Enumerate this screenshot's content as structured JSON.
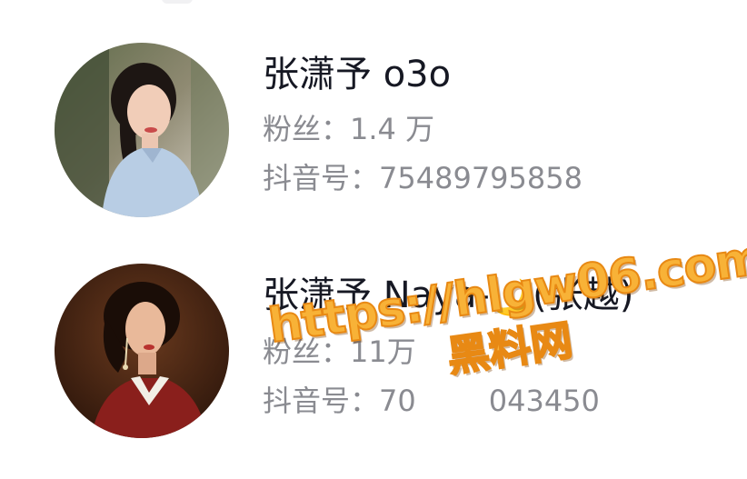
{
  "results": [
    {
      "name": "张潇予 o3o",
      "followers_label": "粉丝：",
      "followers_value": "1.4 万",
      "douyin_id_label": "抖音号：",
      "douyin_id_value": "75489795858",
      "avatar_icon": "user-avatar"
    },
    {
      "name_prefix": "张潇予 Naya-",
      "name_icon": "crescent-moon-icon",
      "name_icon_glyph": "🌙",
      "name_suffix": "(张越)",
      "followers_label": "粉丝：",
      "followers_value": "11万",
      "douyin_id_label": "抖音号：",
      "douyin_id_value": "70",
      "douyin_id_tail": "043450",
      "avatar_icon": "user-avatar"
    }
  ],
  "watermark": {
    "url": "https://hlgw06.com",
    "site": "黑料网"
  },
  "colors": {
    "name_text": "#161823",
    "meta_text": "#8a8b91",
    "watermark_fill": "#f8b237",
    "watermark_stroke": "#e88914",
    "background": "#ffffff"
  }
}
